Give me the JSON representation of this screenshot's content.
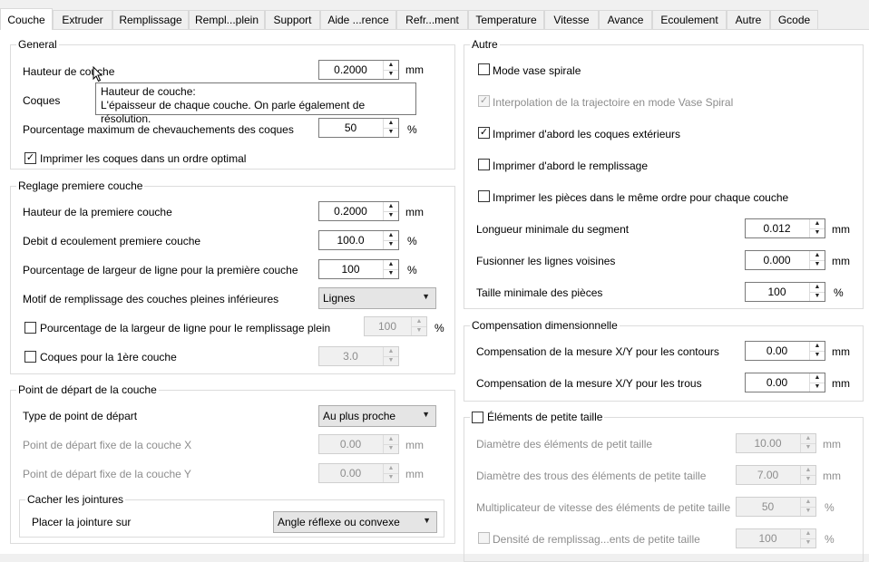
{
  "tabs": [
    "Couche",
    "Extruder",
    "Remplissage",
    "Rempl...plein",
    "Support",
    "Aide ...rence",
    "Refr...ment",
    "Temperature",
    "Vitesse",
    "Avance",
    "Ecoulement",
    "Autre",
    "Gcode"
  ],
  "active_tab": "Couche",
  "general": {
    "title": "General",
    "layer_height_label": "Hauteur de couche",
    "layer_height_value": "0.2000",
    "layer_height_unit": "mm",
    "shells_label": "Coques",
    "overlap_label": "Pourcentage maximum de chevauchements des coques",
    "overlap_value": "50",
    "overlap_unit": "%",
    "optimal_order_label": "Imprimer les coques dans un ordre optimal",
    "optimal_order_checked": true
  },
  "tooltip": {
    "title": "Hauteur de couche:",
    "text": "L'épaisseur de chaque couche. On parle également de résolution."
  },
  "first_layer": {
    "title": "Reglage premiere couche",
    "height_label": "Hauteur de la premiere couche",
    "height_value": "0.2000",
    "height_unit": "mm",
    "flow_label": "Debit d ecoulement premiere couche",
    "flow_value": "100.0",
    "flow_unit": "%",
    "width_label": "Pourcentage de largeur de ligne pour la première couche",
    "width_value": "100",
    "width_unit": "%",
    "pattern_label": "Motif de remplissage des couches pleines inférieures",
    "pattern_value": "Lignes",
    "solid_width_label": "Pourcentage de la largeur de ligne pour le remplissage plein",
    "solid_width_value": "100",
    "solid_width_unit": "%",
    "first_shells_label": "Coques pour la 1ère couche",
    "first_shells_value": "3.0"
  },
  "start_point": {
    "title": "Point de départ de la couche",
    "type_label": "Type de point de départ",
    "type_value": "Au plus proche",
    "fixed_x_label": "Point de départ fixe de la couche X",
    "fixed_x_value": "0.00",
    "fixed_x_unit": "mm",
    "fixed_y_label": "Point de départ fixe de la couche Y",
    "fixed_y_value": "0.00",
    "fixed_y_unit": "mm",
    "seam_title": "Cacher les jointures",
    "seam_label": "Placer la jointure sur",
    "seam_value": "Angle réflexe ou convexe"
  },
  "other": {
    "title": "Autre",
    "vase_label": "Mode vase spirale",
    "vase_checked": false,
    "interp_label": "Interpolation de la trajectoire en mode Vase Spiral",
    "interp_checked": true,
    "outer_first_label": "Imprimer d'abord les coques extérieurs",
    "outer_first_checked": true,
    "infill_first_label": "Imprimer d'abord le remplissage",
    "infill_first_checked": false,
    "same_order_label": "Imprimer les pièces dans le même ordre pour chaque couche",
    "same_order_checked": false,
    "min_segment_label": "Longueur minimale du segment",
    "min_segment_value": "0.012",
    "min_segment_unit": "mm",
    "merge_label": "Fusionner les lignes voisines",
    "merge_value": "0.000",
    "merge_unit": "mm",
    "min_part_label": "Taille minimale des pièces",
    "min_part_value": "100",
    "min_part_unit": "%"
  },
  "compensation": {
    "title": "Compensation dimensionnelle",
    "xy_contour_label": "Compensation de la mesure X/Y pour les contours",
    "xy_contour_value": "0.00",
    "xy_contour_unit": "mm",
    "xy_holes_label": "Compensation de la mesure X/Y pour les trous",
    "xy_holes_value": "0.00",
    "xy_holes_unit": "mm"
  },
  "small_features": {
    "title": "Éléments de petite taille",
    "checked": false,
    "diam_label": "Diamètre des éléments de petit taille",
    "diam_value": "10.00",
    "diam_unit": "mm",
    "hole_diam_label": "Diamètre des trous des éléments de petite taille",
    "hole_diam_value": "7.00",
    "hole_diam_unit": "mm",
    "speed_label": "Multiplicateur de vitesse des éléments de petite taille",
    "speed_value": "50",
    "speed_unit": "%",
    "density_label": "Densité de remplissag...ents de petite taille",
    "density_value": "100",
    "density_unit": "%"
  }
}
